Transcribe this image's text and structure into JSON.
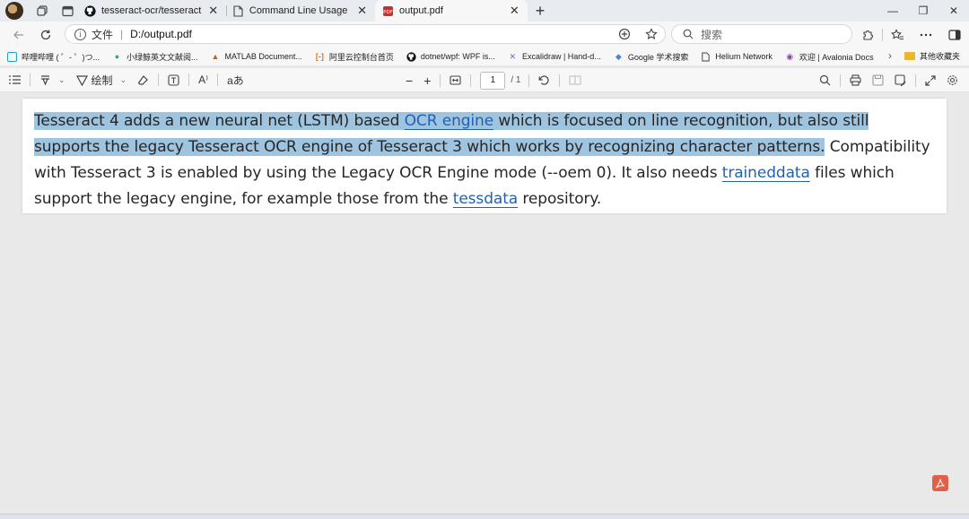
{
  "tabs": [
    {
      "title": "tesseract-ocr/tesseract: Tesseract",
      "icon": "github-icon",
      "active": false
    },
    {
      "title": "Command Line Usage | tessdoc",
      "icon": "page-icon",
      "active": false
    },
    {
      "title": "output.pdf",
      "icon": "pdf-icon",
      "active": true
    }
  ],
  "tab_close_glyph": "✕",
  "new_tab_glyph": "+",
  "window": {
    "minimize": "—",
    "maximize": "❐",
    "close": "✕"
  },
  "address": {
    "scheme_label": "文件",
    "url": "D:/output.pdf"
  },
  "search": {
    "placeholder": "搜索"
  },
  "bookmarks": [
    {
      "label": "哔哩哔哩 ( ゜- ゜)つ...",
      "icon": "bilibili-icon",
      "color": "#1a9fd6"
    },
    {
      "label": "小绿鲸英文文献阅...",
      "icon": "whale-icon",
      "color": "#2db36b"
    },
    {
      "label": "MATLAB Document...",
      "icon": "matlab-icon",
      "color": "#d9532b"
    },
    {
      "label": "阿里云控制台首页",
      "icon": "aliyun-icon",
      "color": "#ff6a00"
    },
    {
      "label": "dotnet/wpf: WPF is...",
      "icon": "github-icon",
      "color": "#111111"
    },
    {
      "label": "Excalidraw | Hand-d...",
      "icon": "excalidraw-icon",
      "color": "#6965db"
    },
    {
      "label": "Google 学术搜索",
      "icon": "scholar-icon",
      "color": "#4285f4"
    },
    {
      "label": "Helium Network",
      "icon": "page-icon",
      "color": "#555555"
    },
    {
      "label": "欢迎 | Avalonia Docs",
      "icon": "avalonia-icon",
      "color": "#8b44ac"
    }
  ],
  "bookmarks_other": "其他收藏夹",
  "pdf_toolbar": {
    "draw_label": "绘制",
    "read_aloud": "A⁾",
    "translate": "aあ",
    "zoom_out": "−",
    "zoom_in": "+",
    "page_current": "1",
    "page_total": "/ 1"
  },
  "document": {
    "segments": [
      {
        "text": "Tesseract 4 adds a new neural net (LSTM) based ",
        "highlight": true,
        "link": false
      },
      {
        "text": "OCR engine",
        "highlight": true,
        "link": true
      },
      {
        "text": " which is focused on line recognition, but also still supports the legacy Tesseract OCR engine of Tesseract 3 which works by recognizing character patterns.",
        "highlight": true,
        "link": false
      },
      {
        "text": " Compatibility with Tesseract 3 is enabled by using the Legacy OCR Engine mode (--oem 0). It also needs ",
        "highlight": false,
        "link": false
      },
      {
        "text": "traineddata",
        "highlight": false,
        "link": true
      },
      {
        "text": " files which support the legacy engine, for example those from the ",
        "highlight": false,
        "link": false
      },
      {
        "text": "tessdata",
        "highlight": false,
        "link": true
      },
      {
        "text": " repository.",
        "highlight": false,
        "link": false
      }
    ]
  },
  "colors": {
    "highlight": "#9fc4e0",
    "link": "#1f62b5",
    "acrobat": "#e1604a"
  }
}
